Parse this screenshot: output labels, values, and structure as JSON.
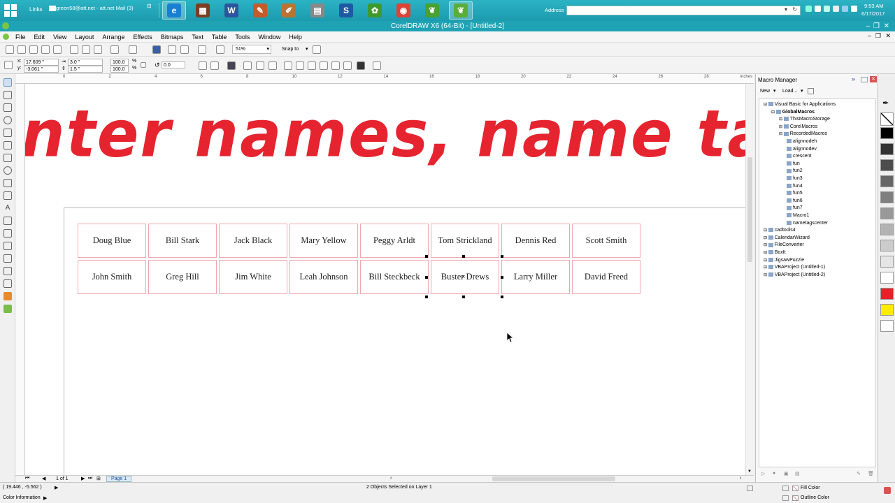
{
  "taskbar": {
    "links_label": "Links",
    "mail_label": "green58@att.net - att.net Mail (3)",
    "address_label": "Address",
    "time": "9:53 AM",
    "date": "6/17/2017",
    "apps": [
      {
        "name": "ie",
        "color": "#1a7fd1",
        "glyph": "e"
      },
      {
        "name": "calendar",
        "color": "#7b3e22",
        "glyph": "▦"
      },
      {
        "name": "word",
        "color": "#2b579a",
        "glyph": "W"
      },
      {
        "name": "tool1",
        "color": "#c45b2a",
        "glyph": "✎"
      },
      {
        "name": "tool2",
        "color": "#b9742f",
        "glyph": "✐"
      },
      {
        "name": "printer",
        "color": "#888888",
        "glyph": "▤"
      },
      {
        "name": "s-app",
        "color": "#1d5aa3",
        "glyph": "S"
      },
      {
        "name": "corel1",
        "color": "#3e9a2f",
        "glyph": "✿"
      },
      {
        "name": "chrome",
        "color": "#db4437",
        "glyph": "◉"
      },
      {
        "name": "corel2",
        "color": "#4aa030",
        "glyph": "❦"
      },
      {
        "name": "corel3",
        "color": "#5aad3a",
        "glyph": "❦"
      }
    ]
  },
  "window": {
    "title": "CorelDRAW X6 (64-Bit) - [Untitled-2]"
  },
  "menu": [
    "File",
    "Edit",
    "View",
    "Layout",
    "Arrange",
    "Effects",
    "Bitmaps",
    "Text",
    "Table",
    "Tools",
    "Window",
    "Help"
  ],
  "toolbar": {
    "zoom": "51%",
    "snap_to": "Snap to",
    "x": "17.609 \"",
    "y": "-3.061 \"",
    "width": "3.0 \"",
    "height": "1.5 \"",
    "scale_w": "100.0",
    "scale_h": "100.0",
    "pct": "%",
    "rotation": "0.0"
  },
  "ruler": {
    "unit": "inches",
    "ticks": [
      "0",
      "2",
      "4",
      "6",
      "8",
      "10",
      "12",
      "14",
      "16",
      "18",
      "20",
      "22",
      "24",
      "26",
      "28"
    ]
  },
  "canvas": {
    "headline": "nter names, name tag",
    "row1": [
      "Doug Blue",
      "Bill Stark",
      "Jack Black",
      "Mary Yellow",
      "Peggy Arldt",
      "Tom Strickland",
      "Dennis Red",
      "Scott Smith"
    ],
    "row2": [
      "John Smith",
      "Greg Hill",
      "Jim White",
      "Leah Johnson",
      "Bill Steckbeck",
      "Buster Drews",
      "Larry Miller",
      "David Freed"
    ]
  },
  "docker": {
    "title": "Macro Manager",
    "new_label": "New",
    "load_label": "Load...",
    "tree": [
      {
        "label": "Visual Basic for Applications",
        "level": 0,
        "bold": false
      },
      {
        "label": "GlobalMacros",
        "level": 1,
        "bold": true
      },
      {
        "label": "ThisMacroStorage",
        "level": 2,
        "bold": false
      },
      {
        "label": "CorelMacros",
        "level": 2,
        "bold": false
      },
      {
        "label": "RecordedMacros",
        "level": 2,
        "bold": false
      },
      {
        "label": "alignnodeh",
        "level": 3,
        "bold": false
      },
      {
        "label": "alignnodev",
        "level": 3,
        "bold": false
      },
      {
        "label": "crescent",
        "level": 3,
        "bold": false
      },
      {
        "label": "fun",
        "level": 3,
        "bold": false
      },
      {
        "label": "fun2",
        "level": 3,
        "bold": false
      },
      {
        "label": "fun3",
        "level": 3,
        "bold": false
      },
      {
        "label": "fun4",
        "level": 3,
        "bold": false
      },
      {
        "label": "fun5",
        "level": 3,
        "bold": false
      },
      {
        "label": "fun6",
        "level": 3,
        "bold": false
      },
      {
        "label": "fun7",
        "level": 3,
        "bold": false
      },
      {
        "label": "Macro1",
        "level": 3,
        "bold": false
      },
      {
        "label": "nametagscenter",
        "level": 3,
        "bold": false
      },
      {
        "label": "cadtools4",
        "level": 0,
        "bold": false
      },
      {
        "label": "CalendarWizard",
        "level": 0,
        "bold": false
      },
      {
        "label": "FileConverter",
        "level": 0,
        "bold": false
      },
      {
        "label": "BoxIt",
        "level": 0,
        "bold": false
      },
      {
        "label": "JigsawPuzzle",
        "level": 0,
        "bold": false
      },
      {
        "label": "VBAProject (Untitled-1)",
        "level": 0,
        "bold": false
      },
      {
        "label": "VBAProject (Untitled-2)",
        "level": 0,
        "bold": false
      }
    ]
  },
  "palette": [
    "#000000",
    "#333333",
    "#4d4d4d",
    "#666666",
    "#7f7f7f",
    "#999999",
    "#b3b3b3",
    "#cccccc",
    "#e5e5e5",
    "#ffffff",
    "#e62129",
    "#ffec00",
    "#ffffff"
  ],
  "pager": {
    "count": "1 of 1",
    "page_tab": "Page 1"
  },
  "status": {
    "coords": "( 19.446 , -5.562 )",
    "selection": "2 Objects Selected on Layer 1",
    "color_info": "Color Information",
    "fill_color": "Fill Color",
    "outline_color": "Outline Color"
  }
}
